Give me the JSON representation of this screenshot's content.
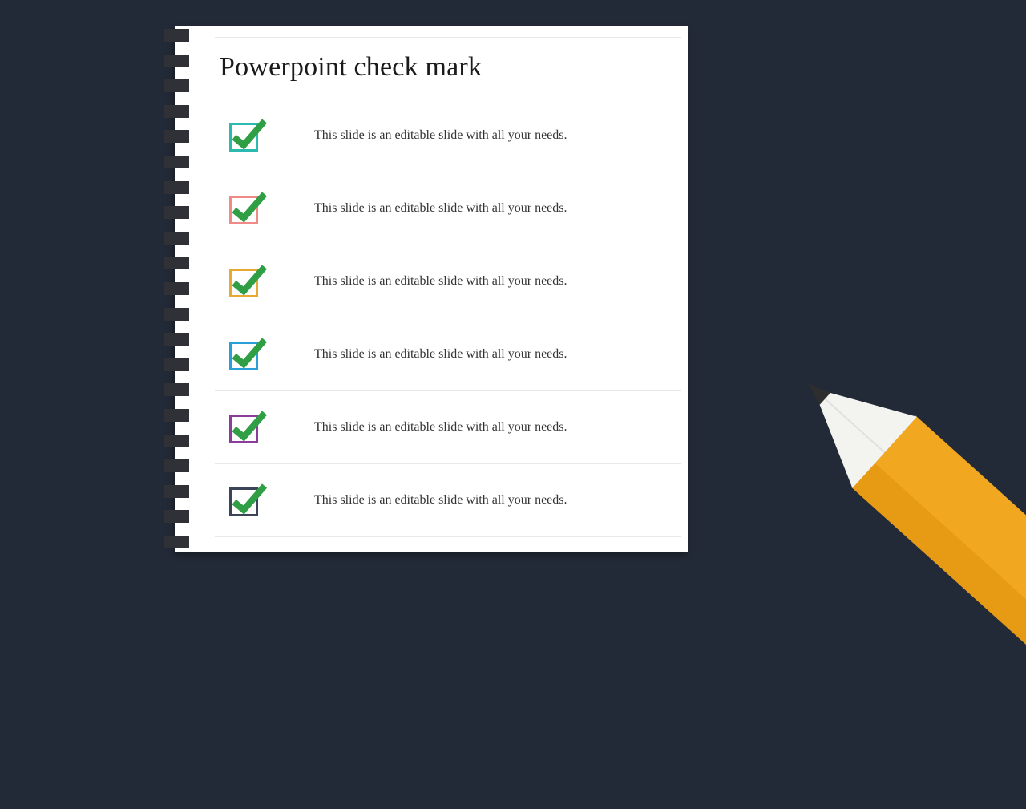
{
  "title": "Powerpoint check mark",
  "tick_color": "#2f9e44",
  "rows": [
    {
      "box_color": "#2bb9b0",
      "text": "This slide is an editable slide with all your needs."
    },
    {
      "box_color": "#f08a87",
      "text": "This slide is an editable slide with all your needs."
    },
    {
      "box_color": "#e8a832",
      "text": "This slide is an editable slide with all your needs."
    },
    {
      "box_color": "#2aa0d8",
      "text": "This slide is an editable slide with all your needs."
    },
    {
      "box_color": "#8a3d99",
      "text": "This slide is an editable slide with all your needs."
    },
    {
      "box_color": "#3b4557",
      "text": "This slide is an editable slide with all your needs."
    }
  ]
}
